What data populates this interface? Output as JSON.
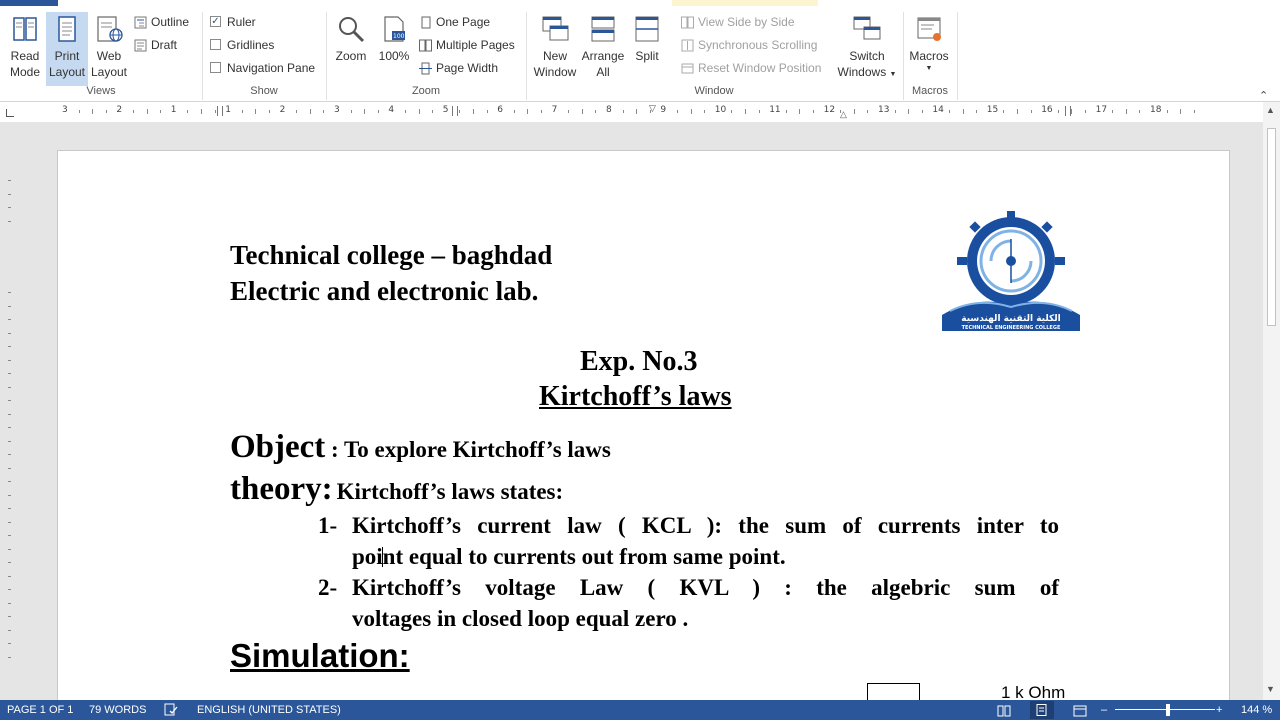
{
  "ribbon": {
    "views": {
      "group_label": "Views",
      "read_mode": [
        "Read",
        "Mode"
      ],
      "print_layout": [
        "Print",
        "Layout"
      ],
      "web_layout": [
        "Web",
        "Layout"
      ],
      "outline": "Outline",
      "draft": "Draft"
    },
    "show": {
      "group_label": "Show",
      "ruler": "Ruler",
      "ruler_checked": true,
      "gridlines": "Gridlines",
      "navigation_pane": "Navigation Pane"
    },
    "zoom": {
      "group_label": "Zoom",
      "zoom": "Zoom",
      "hundred": "100%",
      "one_page": "One Page",
      "multiple_pages": "Multiple Pages",
      "page_width": "Page Width"
    },
    "window": {
      "group_label": "Window",
      "new_window": [
        "New",
        "Window"
      ],
      "arrange_all": [
        "Arrange",
        "All"
      ],
      "split": "Split",
      "view_side_by_side": "View Side by Side",
      "synchronous_scrolling": "Synchronous Scrolling",
      "reset_window_position": "Reset Window Position",
      "switch_windows": [
        "Switch",
        "Windows"
      ]
    },
    "macros": {
      "group_label": "Macros",
      "macros": "Macros"
    }
  },
  "ruler": {
    "labels": [
      "3",
      "2",
      "1",
      "1",
      "2",
      "3",
      "4",
      "5",
      "6",
      "7",
      "8",
      "9",
      "10",
      "11",
      "12",
      "13",
      "14",
      "15",
      "16",
      "17",
      "18"
    ]
  },
  "document": {
    "line1": "Technical college – baghdad",
    "line2": "Electric and electronic lab.",
    "logo_text_ar": "الكلية التقنية الهندسية",
    "logo_text_en": "TECHNICAL ENGINEERING COLLEGE",
    "exp_no": "Exp. No.3",
    "exp_title": "Kirtchoff’s laws",
    "object_label": "Object",
    "object_text": " : To explore Kirtchoff’s laws",
    "theory_label": "theory:",
    "theory_text": "Kirtchoff’s laws states:",
    "item1_num": "1-",
    "item1_line1": "Kirtchoff’s current law ( KCL ): the sum of currents inter to",
    "item1_line2": "point equal to currents out from same point.",
    "item2_num": "2-",
    "item2_line1": "Kirtchoff’s voltage Law ( KVL ) : the algebric sum of",
    "item2_line2": "voltages in closed loop equal zero .",
    "simulation": "Simulation:",
    "resistor_label": "1 k Ohm"
  },
  "status": {
    "page": "PAGE 1 OF 1",
    "words": "79 WORDS",
    "language": "ENGLISH (UNITED STATES)",
    "zoom": "144 %"
  },
  "colors": {
    "accent": "#2b579a",
    "logo_blue": "#1a4fa0",
    "logo_light": "#7fb3e6"
  }
}
